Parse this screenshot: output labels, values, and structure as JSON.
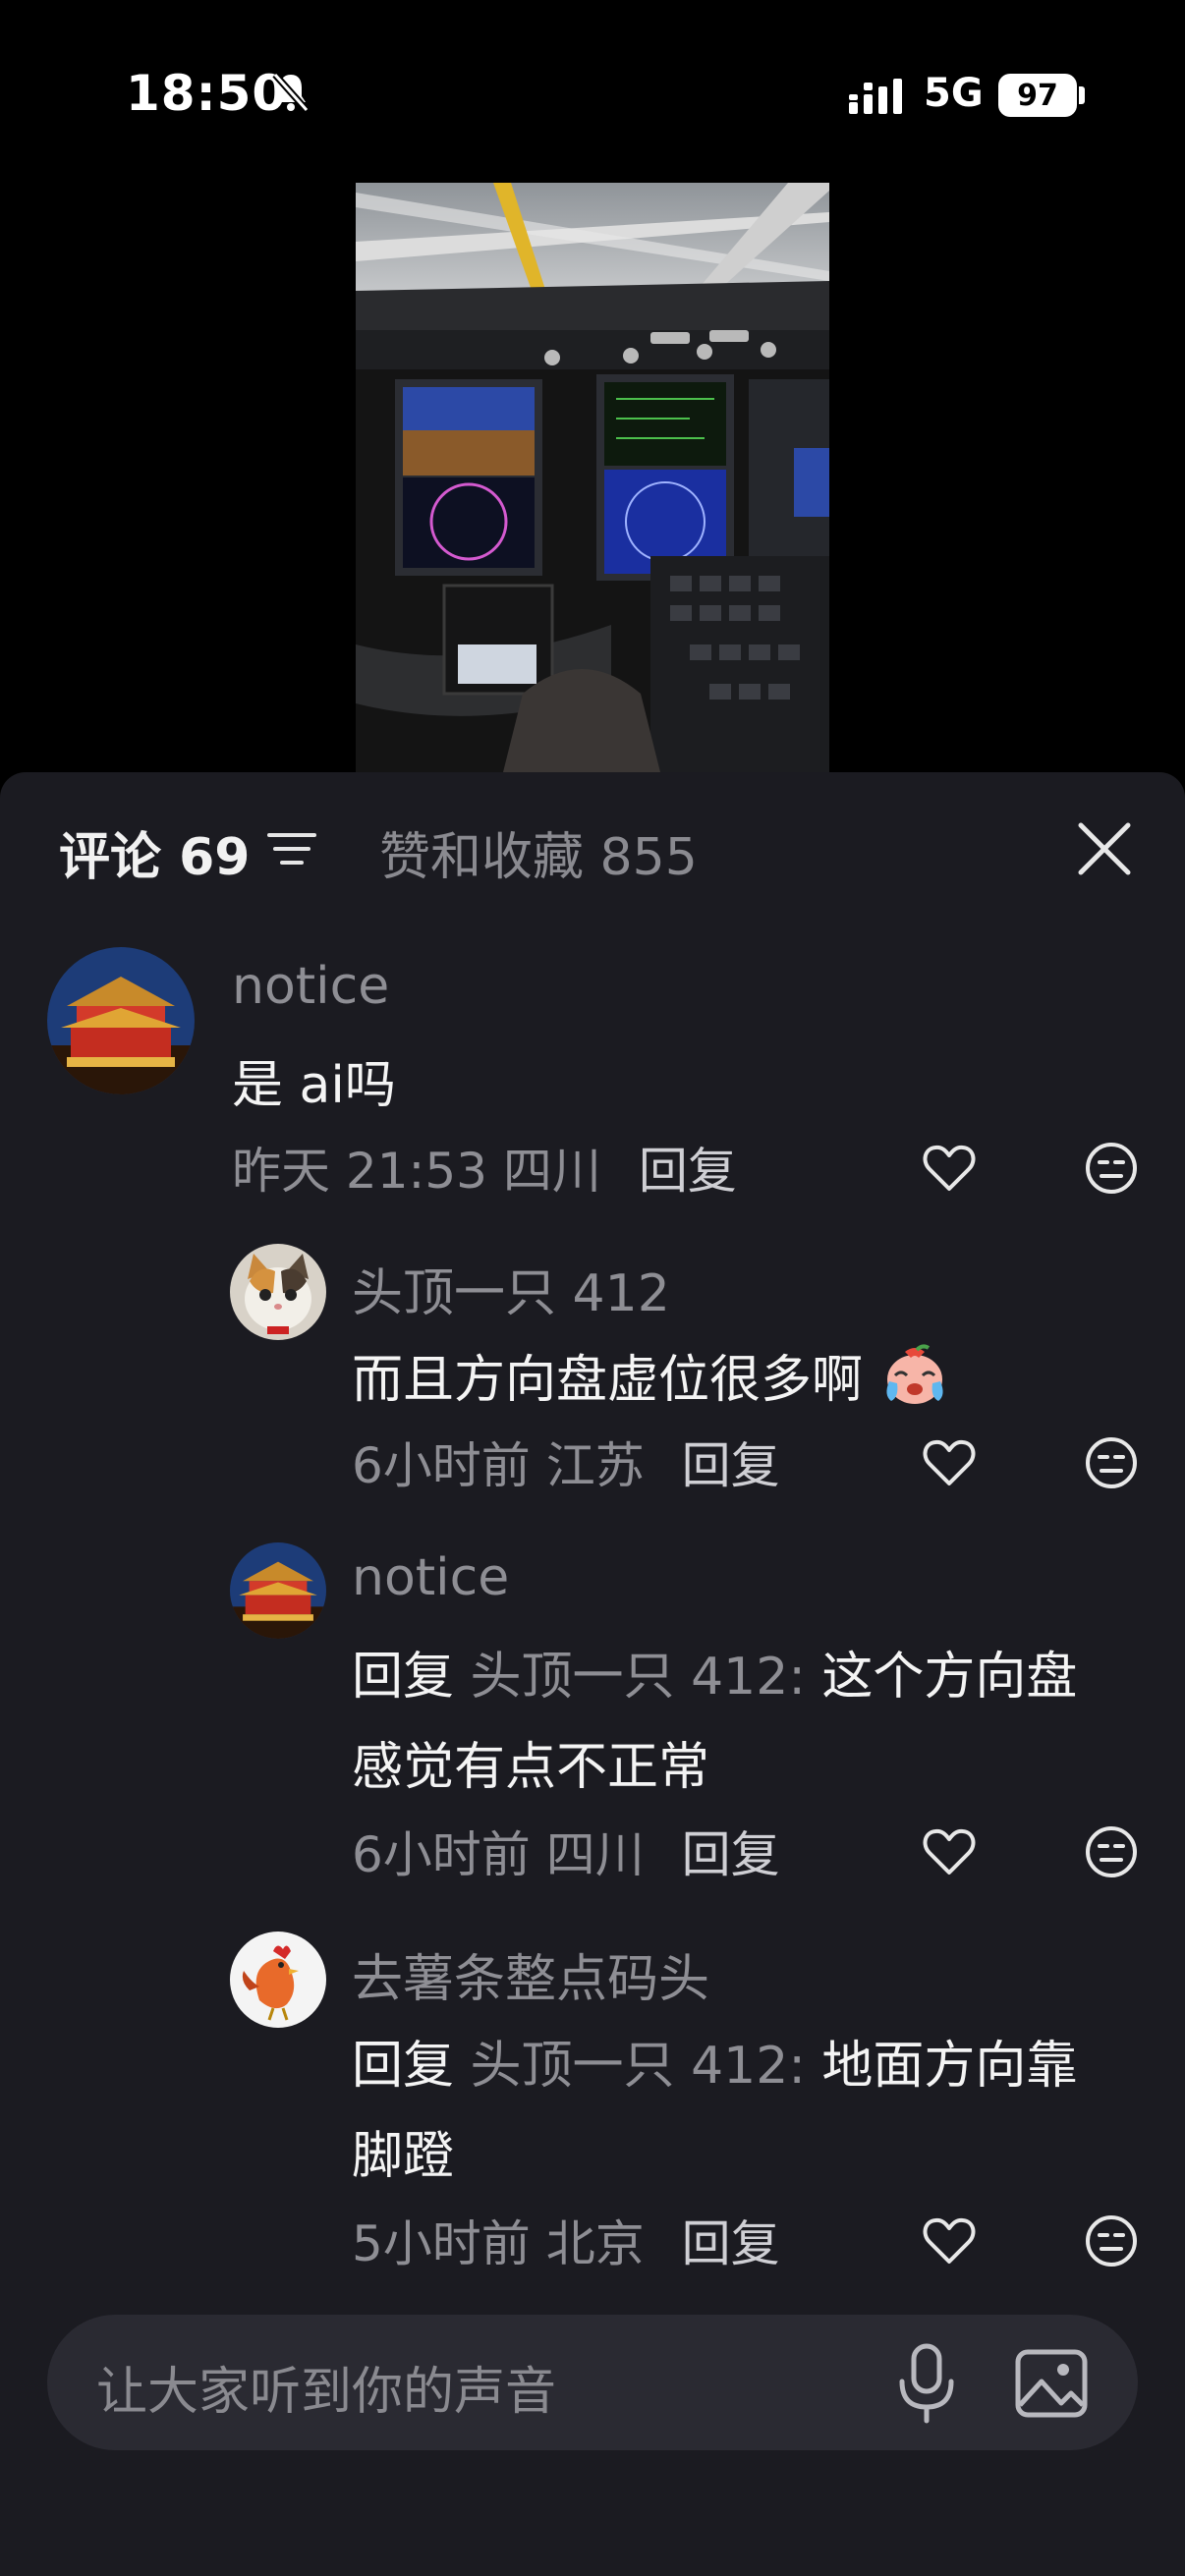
{
  "status_bar": {
    "time": "18:50",
    "network": "5G",
    "battery": "97"
  },
  "sheet": {
    "tab_comments": "评论 69",
    "tab_likes": "赞和收藏 855"
  },
  "comments": [
    {
      "name": "notice",
      "text": "是 ai吗",
      "time": "昨天 21:53",
      "location": "四川",
      "reply": "回复"
    },
    {
      "name": "头顶一只 412",
      "text": "而且方向盘虚位很多啊",
      "time": "6小时前",
      "location": "江苏",
      "reply": "回复"
    },
    {
      "name": "notice",
      "reply_prefix": "回复",
      "reply_target": "头顶一只 412:",
      "text_line1": "这个方向盘",
      "text_line2": "感觉有点不正常",
      "time": "6小时前",
      "location": "四川",
      "reply": "回复"
    },
    {
      "name": "去薯条整点码头",
      "reply_prefix": "回复",
      "reply_target": "头顶一只 412:",
      "text_line1": "地面方向靠",
      "text_line2": "脚蹬",
      "time": "5小时前",
      "location": "北京",
      "reply": "回复"
    }
  ],
  "input": {
    "placeholder": "让大家听到你的声音"
  }
}
